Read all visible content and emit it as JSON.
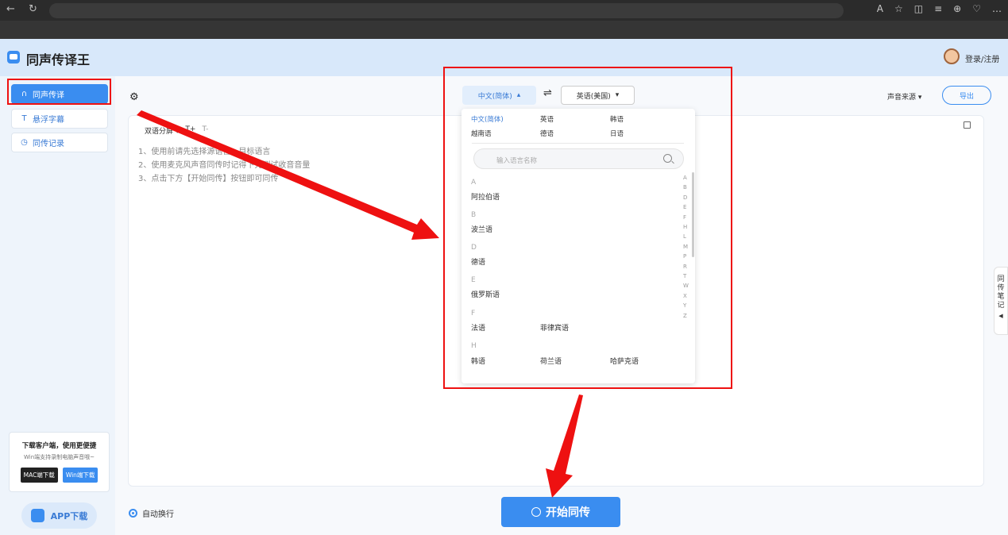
{
  "browser": {
    "back_icon": "back-arrow-icon",
    "refresh_icon": "refresh-icon",
    "toolbar_icons": [
      "read-aloud-icon",
      "favorite-icon",
      "split-screen-icon",
      "favorites-icon",
      "collections-icon",
      "extension-icon",
      "more-icon"
    ]
  },
  "app": {
    "title": "同声传译王",
    "login": "登录/注册"
  },
  "sidebar": {
    "items": [
      {
        "label": "同声传译",
        "active": true
      },
      {
        "label": "悬浮字幕"
      },
      {
        "label": "同传记录"
      }
    ],
    "promo": {
      "title": "下载客户端，使用更便捷",
      "subtitle": "Win端支持录制电脑声音哦~",
      "mac_btn": "MAC端下载",
      "win_btn": "Win端下载"
    },
    "app_download": "APP下载"
  },
  "toolbar": {
    "mode": "双语分屏 ▾",
    "font_up": "T+",
    "font_down": "T-"
  },
  "instructions": [
    "1、使用前请先选择源语言、目标语言",
    "2、使用麦克风声音同传时记得下先测试收音音量",
    "3、点击下方【开始同传】按钮即可同传"
  ],
  "languages": {
    "source": "中文(简体)",
    "source_caret": "▴",
    "swap": "⇌",
    "target": "英语(美国)",
    "target_caret": "▾"
  },
  "sound_source": "声音来源 ▾",
  "export": "导出",
  "dropdown": {
    "common": [
      "中文(简体)",
      "英语",
      "韩语",
      "越南语",
      "德语",
      "日语"
    ],
    "search_placeholder": "输入语言名称",
    "groups": [
      {
        "letter": "A",
        "langs": [
          "阿拉伯语"
        ]
      },
      {
        "letter": "B",
        "langs": [
          "波兰语"
        ]
      },
      {
        "letter": "D",
        "langs": [
          "德语"
        ]
      },
      {
        "letter": "E",
        "langs": [
          "俄罗斯语"
        ]
      },
      {
        "letter": "F",
        "langs": [
          "法语",
          "菲律宾语"
        ]
      },
      {
        "letter": "H",
        "langs": [
          "韩语",
          "荷兰语",
          "哈萨克语"
        ]
      }
    ],
    "alphabet": [
      "A",
      "B",
      "D",
      "E",
      "F",
      "H",
      "L",
      "M",
      "P",
      "R",
      "T",
      "W",
      "X",
      "Y",
      "Z"
    ]
  },
  "side_note": "同传笔记",
  "bottom": {
    "auto_wrap": "自动换行",
    "start": "开始同传"
  },
  "colors": {
    "accent": "#3a8df0",
    "highlight": "#e11111"
  }
}
